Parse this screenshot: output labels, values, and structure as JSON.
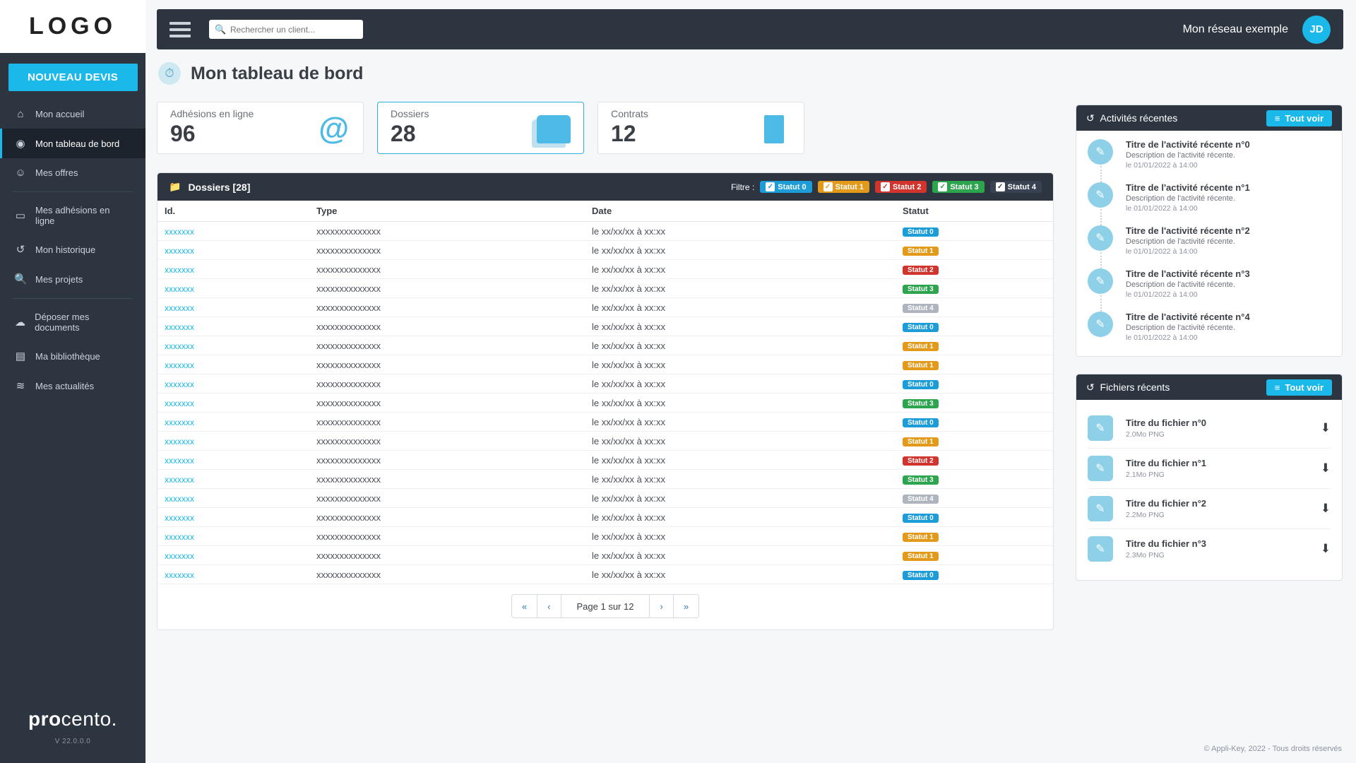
{
  "logo": "LOGO",
  "topbar": {
    "search_placeholder": "Rechercher un client...",
    "network_label": "Mon réseau exemple",
    "avatar": "JD"
  },
  "sidebar": {
    "primary_button": "NOUVEAU DEVIS",
    "items": [
      {
        "label": "Mon accueil",
        "icon": "⌂"
      },
      {
        "label": "Mon tableau de bord",
        "icon": "◉"
      },
      {
        "label": "Mes offres",
        "icon": "☺"
      },
      {
        "label": "Mes adhésions en ligne",
        "icon": "▭"
      },
      {
        "label": "Mon historique",
        "icon": "↺"
      },
      {
        "label": "Mes projets",
        "icon": "🔍"
      },
      {
        "label": "Déposer mes documents",
        "icon": "☁"
      },
      {
        "label": "Ma bibliothèque",
        "icon": "▤"
      },
      {
        "label": "Mes actualités",
        "icon": "≋"
      }
    ],
    "brand_html": "procento.",
    "version": "V 22.0.0.0"
  },
  "page_title": "Mon tableau de bord",
  "stat_cards": [
    {
      "label": "Adhésions en ligne",
      "value": "96"
    },
    {
      "label": "Dossiers",
      "value": "28"
    },
    {
      "label": "Contrats",
      "value": "12"
    }
  ],
  "dossiers": {
    "heading": "Dossiers [28]",
    "filter_label": "Filtre :",
    "filters": [
      "Statut 0",
      "Statut 1",
      "Statut 2",
      "Statut 3",
      "Statut 4"
    ],
    "columns": [
      "Id.",
      "Type",
      "Date",
      "Statut"
    ],
    "rows": [
      {
        "id": "xxxxxxx",
        "type": "xxxxxxxxxxxxxx",
        "date": "le xx/xx/xx à xx:xx",
        "status": "Statut 0",
        "s": 0
      },
      {
        "id": "xxxxxxx",
        "type": "xxxxxxxxxxxxxx",
        "date": "le xx/xx/xx à xx:xx",
        "status": "Statut 1",
        "s": 1
      },
      {
        "id": "xxxxxxx",
        "type": "xxxxxxxxxxxxxx",
        "date": "le xx/xx/xx à xx:xx",
        "status": "Statut 2",
        "s": 2
      },
      {
        "id": "xxxxxxx",
        "type": "xxxxxxxxxxxxxx",
        "date": "le xx/xx/xx à xx:xx",
        "status": "Statut 3",
        "s": 3
      },
      {
        "id": "xxxxxxx",
        "type": "xxxxxxxxxxxxxx",
        "date": "le xx/xx/xx à xx:xx",
        "status": "Statut 4",
        "s": 4
      },
      {
        "id": "xxxxxxx",
        "type": "xxxxxxxxxxxxxx",
        "date": "le xx/xx/xx à xx:xx",
        "status": "Statut 0",
        "s": 0
      },
      {
        "id": "xxxxxxx",
        "type": "xxxxxxxxxxxxxx",
        "date": "le xx/xx/xx à xx:xx",
        "status": "Statut 1",
        "s": 1
      },
      {
        "id": "xxxxxxx",
        "type": "xxxxxxxxxxxxxx",
        "date": "le xx/xx/xx à xx:xx",
        "status": "Statut 1",
        "s": 1
      },
      {
        "id": "xxxxxxx",
        "type": "xxxxxxxxxxxxxx",
        "date": "le xx/xx/xx à xx:xx",
        "status": "Statut 0",
        "s": 0
      },
      {
        "id": "xxxxxxx",
        "type": "xxxxxxxxxxxxxx",
        "date": "le xx/xx/xx à xx:xx",
        "status": "Statut 3",
        "s": 3
      },
      {
        "id": "xxxxxxx",
        "type": "xxxxxxxxxxxxxx",
        "date": "le xx/xx/xx à xx:xx",
        "status": "Statut 0",
        "s": 0
      },
      {
        "id": "xxxxxxx",
        "type": "xxxxxxxxxxxxxx",
        "date": "le xx/xx/xx à xx:xx",
        "status": "Statut 1",
        "s": 1
      },
      {
        "id": "xxxxxxx",
        "type": "xxxxxxxxxxxxxx",
        "date": "le xx/xx/xx à xx:xx",
        "status": "Statut 2",
        "s": 2
      },
      {
        "id": "xxxxxxx",
        "type": "xxxxxxxxxxxxxx",
        "date": "le xx/xx/xx à xx:xx",
        "status": "Statut 3",
        "s": 3
      },
      {
        "id": "xxxxxxx",
        "type": "xxxxxxxxxxxxxx",
        "date": "le xx/xx/xx à xx:xx",
        "status": "Statut 4",
        "s": 4
      },
      {
        "id": "xxxxxxx",
        "type": "xxxxxxxxxxxxxx",
        "date": "le xx/xx/xx à xx:xx",
        "status": "Statut 0",
        "s": 0
      },
      {
        "id": "xxxxxxx",
        "type": "xxxxxxxxxxxxxx",
        "date": "le xx/xx/xx à xx:xx",
        "status": "Statut 1",
        "s": 1
      },
      {
        "id": "xxxxxxx",
        "type": "xxxxxxxxxxxxxx",
        "date": "le xx/xx/xx à xx:xx",
        "status": "Statut 1",
        "s": 1
      },
      {
        "id": "xxxxxxx",
        "type": "xxxxxxxxxxxxxx",
        "date": "le xx/xx/xx à xx:xx",
        "status": "Statut 0",
        "s": 0
      }
    ],
    "page_info": "Page 1 sur 12"
  },
  "activities": {
    "heading": "Activités récentes",
    "view_all": "Tout voir",
    "items": [
      {
        "title": "Titre de l'activité récente n°0",
        "desc": "Description de l'activité récente.",
        "date": "le 01/01/2022 à 14:00"
      },
      {
        "title": "Titre de l'activité récente n°1",
        "desc": "Description de l'activité récente.",
        "date": "le 01/01/2022 à 14:00"
      },
      {
        "title": "Titre de l'activité récente n°2",
        "desc": "Description de l'activité récente.",
        "date": "le 01/01/2022 à 14:00"
      },
      {
        "title": "Titre de l'activité récente n°3",
        "desc": "Description de l'activité récente.",
        "date": "le 01/01/2022 à 14:00"
      },
      {
        "title": "Titre de l'activité récente n°4",
        "desc": "Description de l'activité récente.",
        "date": "le 01/01/2022 à 14:00"
      }
    ]
  },
  "files": {
    "heading": "Fichiers récents",
    "view_all": "Tout voir",
    "items": [
      {
        "title": "Titre du fichier n°0",
        "meta": "2.0Mo PNG"
      },
      {
        "title": "Titre du fichier n°1",
        "meta": "2.1Mo PNG"
      },
      {
        "title": "Titre du fichier n°2",
        "meta": "2.2Mo PNG"
      },
      {
        "title": "Titre du fichier n°3",
        "meta": "2.3Mo PNG"
      }
    ]
  },
  "footer": "© Appli-Key, 2022 - Tous droits réservés"
}
